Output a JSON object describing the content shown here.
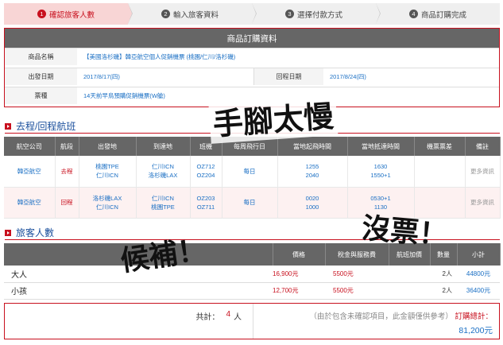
{
  "steps": [
    {
      "num": "1",
      "label": "確認旅客人數"
    },
    {
      "num": "2",
      "label": "輸入旅客資料"
    },
    {
      "num": "3",
      "label": "選擇付款方式"
    },
    {
      "num": "4",
      "label": "商品訂購完成"
    }
  ],
  "order": {
    "title": "商品訂購資料",
    "product_label": "商品名稱",
    "product_value": "【美國洛杉磯】韓亞航空個人促銷機票 (桃園/仁川/洛杉磯)",
    "depart_label": "出發日期",
    "depart_value": "2017/8/17(四)",
    "return_label": "回程日期",
    "return_value": "2017/8/24(四)",
    "ticket_label": "票種",
    "ticket_value": "14天前早鳥預購促銷機票(W艙)"
  },
  "flights": {
    "section_title": "去程/回程航班",
    "headers": [
      "航空公司",
      "航段",
      "出發地",
      "到達地",
      "班機",
      "每周飛行日",
      "當地起飛時間",
      "當地抵達時間",
      "機票票差",
      "備註"
    ],
    "rows": [
      {
        "airline": "韓亞航空",
        "segment": "去程",
        "from1": "桃園TPE",
        "from2": "仁川ICN",
        "to1": "仁川ICN",
        "to2": "洛杉磯LAX",
        "flight1": "OZ712",
        "flight2": "OZ204",
        "days": "每日",
        "dep1": "1255",
        "dep2": "2040",
        "arr1": "1630",
        "arr2": "1550+1",
        "diff": "",
        "note": "更多資訊"
      },
      {
        "airline": "韓亞航空",
        "segment": "回程",
        "from1": "洛杉磯LAX",
        "from2": "仁川ICN",
        "to1": "仁川ICN",
        "to2": "桃園TPE",
        "flight1": "OZ203",
        "flight2": "OZ711",
        "days": "每日",
        "dep1": "0020",
        "dep2": "1000",
        "arr1": "0530+1",
        "arr2": "1130",
        "diff": "",
        "note": "更多資訊"
      }
    ]
  },
  "passengers": {
    "section_title": "旅客人數",
    "headers": [
      "",
      "價格",
      "稅金與服務費",
      "航班加價",
      "數量",
      "小計"
    ],
    "rows": [
      {
        "type": "大人",
        "price": "16,900元",
        "tax": "5500元",
        "surcharge": "",
        "qty": "2人",
        "subtotal": "44800元"
      },
      {
        "type": "小孩",
        "price": "12,700元",
        "tax": "5500元",
        "surcharge": "",
        "qty": "2人",
        "subtotal": "36400元"
      }
    ]
  },
  "totals": {
    "count_label": "共計：",
    "count_value": "4",
    "count_unit": "人",
    "note": "（由於包含未確認項目，此金額僅供參考）",
    "total_label": "訂購總計：",
    "total_value": "81,200元"
  },
  "annotations": {
    "slow": "手腳太慢",
    "waitlist": "候補！",
    "no_tickets": "沒票！"
  },
  "colors": {
    "accent": "#c8101e",
    "link": "#1a6fc4",
    "header_bg": "#666666"
  }
}
